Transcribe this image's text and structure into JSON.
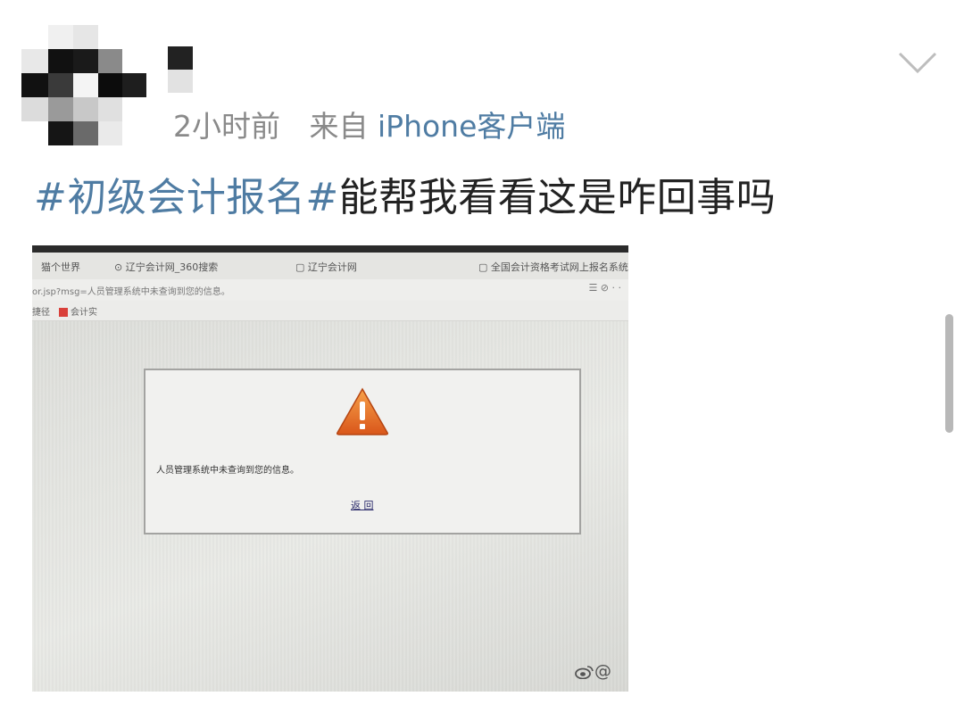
{
  "header": {
    "time": "2小时前",
    "source_prefix": "来自",
    "source_client": "iPhone客户端"
  },
  "post": {
    "hashtag": "#初级会计报名#",
    "text": "能帮我看看这是咋回事吗"
  },
  "photo": {
    "tabs": [
      "猫个世界",
      "辽宁会计网_360搜索",
      "辽宁会计网",
      "全国会计资格考试网上报名系统"
    ],
    "address": "or.jsp?msg=人员管理系统中未查询到您的信息。",
    "favorites": [
      "捷径",
      "会计实"
    ],
    "dialog": {
      "message": "人员管理系统中未查询到您的信息。",
      "button": "返 回"
    },
    "watermark": "@"
  },
  "icons": {
    "chevron": "chevron-down-icon",
    "warning": "warning-triangle-icon",
    "weibo": "weibo-logo-icon"
  },
  "colors": {
    "link": "#4f7ca3",
    "meta": "#8a8a8a",
    "warning": "#e8791f"
  }
}
